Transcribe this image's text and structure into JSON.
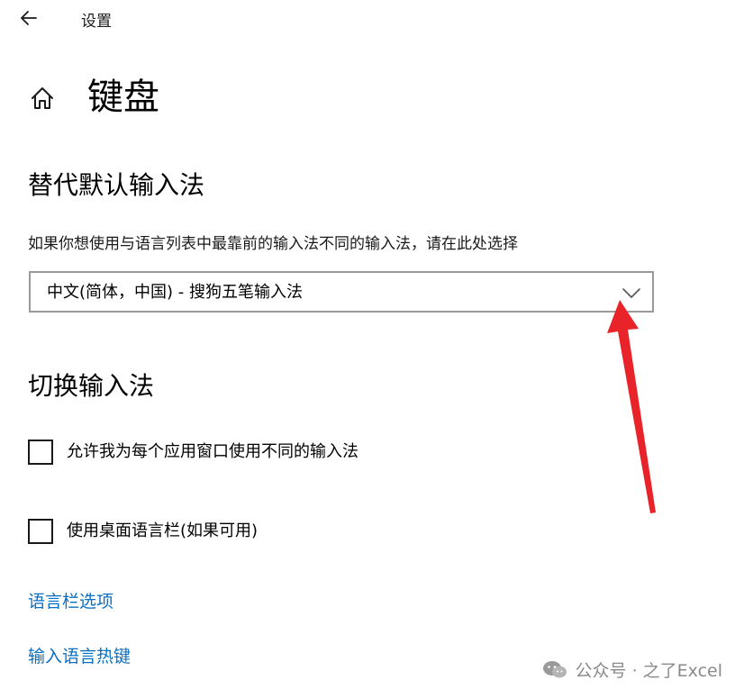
{
  "window": {
    "title": "设置"
  },
  "page": {
    "title": "键盘"
  },
  "override_section": {
    "title": "替代默认输入法",
    "description": "如果你想使用与语言列表中最靠前的输入法不同的输入法，请在此处选择",
    "dropdown_value": "中文(简体，中国) - 搜狗五笔输入法"
  },
  "switch_section": {
    "title": "切换输入法",
    "checkboxes": [
      {
        "label": "允许我为每个应用窗口使用不同的输入法",
        "checked": false
      },
      {
        "label": "使用桌面语言栏(如果可用)",
        "checked": false
      }
    ]
  },
  "links": [
    {
      "label": "语言栏选项"
    },
    {
      "label": "输入语言热键"
    }
  ],
  "watermark": {
    "text": "公众号 · 之了Excel"
  },
  "colors": {
    "link": "#0a6fc2",
    "annotation_arrow": "#e8242a",
    "dropdown_border": "#9a9a9a"
  }
}
